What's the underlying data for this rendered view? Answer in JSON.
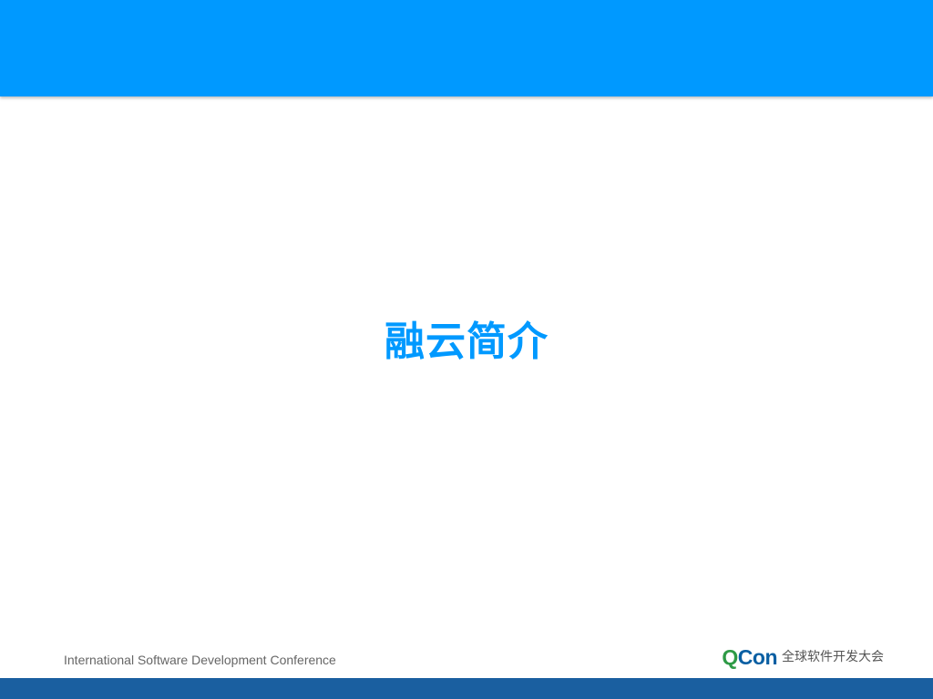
{
  "slide": {
    "title": "融云简介"
  },
  "footer": {
    "conference_name": "International Software Development Conference",
    "logo_q": "Q",
    "logo_con": "Con",
    "logo_subtitle": "全球软件开发大会"
  },
  "colors": {
    "header_bar": "#0099ff",
    "title": "#0099ff",
    "footer_bar": "#1a5fa0",
    "logo_q": "#2e9a46",
    "logo_con": "#0a5fa3"
  }
}
